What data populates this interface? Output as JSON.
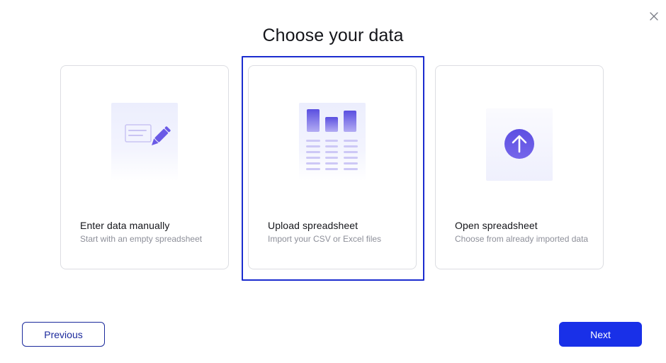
{
  "dialog": {
    "title": "Choose your data",
    "close_icon": "close-icon"
  },
  "cards": [
    {
      "title": "Enter data manually",
      "description": "Start with an empty spreadsheet",
      "icon": "edit-form-icon",
      "selected": false
    },
    {
      "title": "Upload spreadsheet",
      "description": "Import your CSV or Excel files",
      "icon": "spreadsheet-chart-icon",
      "selected": true
    },
    {
      "title": "Open spreadsheet",
      "description": "Choose from already imported data",
      "icon": "upload-arrow-icon",
      "selected": false
    }
  ],
  "footer": {
    "previous_label": "Previous",
    "next_label": "Next"
  },
  "colors": {
    "accent": "#1930e8",
    "selection_outline": "#1b2ccf",
    "icon_purple": "#6a5ae6",
    "muted_text": "#8d8f99"
  }
}
